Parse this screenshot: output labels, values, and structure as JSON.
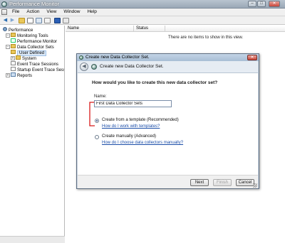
{
  "window": {
    "title": "Performance Monitor"
  },
  "menu": [
    "File",
    "Action",
    "View",
    "Window",
    "Help"
  ],
  "tree": {
    "nodes": [
      {
        "label": "Performance",
        "level": 0,
        "toggle": "",
        "icon": "gear"
      },
      {
        "label": "Monitoring Tools",
        "level": 1,
        "toggle": "−",
        "icon": "folder"
      },
      {
        "label": "Performance Monitor",
        "level": 2,
        "toggle": "",
        "icon": "chart"
      },
      {
        "label": "Data Collector Sets",
        "level": 1,
        "toggle": "−",
        "icon": "folder"
      },
      {
        "label": "User Defined",
        "level": 2,
        "toggle": "",
        "icon": "folder",
        "selected": true
      },
      {
        "label": "System",
        "level": 2,
        "toggle": "+",
        "icon": "folder"
      },
      {
        "label": "Event Trace Sessions",
        "level": 2,
        "toggle": "",
        "icon": "trace"
      },
      {
        "label": "Startup Event Trace Sess",
        "level": 2,
        "toggle": "",
        "icon": "trace"
      },
      {
        "label": "Reports",
        "level": 1,
        "toggle": "+",
        "icon": "report"
      }
    ]
  },
  "list": {
    "columns": [
      "Name",
      "Status"
    ],
    "empty_message": "There are no items to show in this view."
  },
  "dialog": {
    "title": "Create new Data Collector Set.",
    "header": "Create new Data Collector Set.",
    "question": "How would you like to create this new data collector set?",
    "name_label": "Name:",
    "name_value": "First Data Collector Sets",
    "option_template": "Create from a template (Recommended)",
    "link_template": "How do I work with templates?",
    "option_manual": "Create manually (Advanced)",
    "link_manual": "How do I choose data collectors manually?",
    "selected_option": "template",
    "buttons": {
      "next": "Next",
      "finish": "Finish",
      "cancel": "Cancel"
    },
    "annotation_color": "#d81a1a"
  }
}
